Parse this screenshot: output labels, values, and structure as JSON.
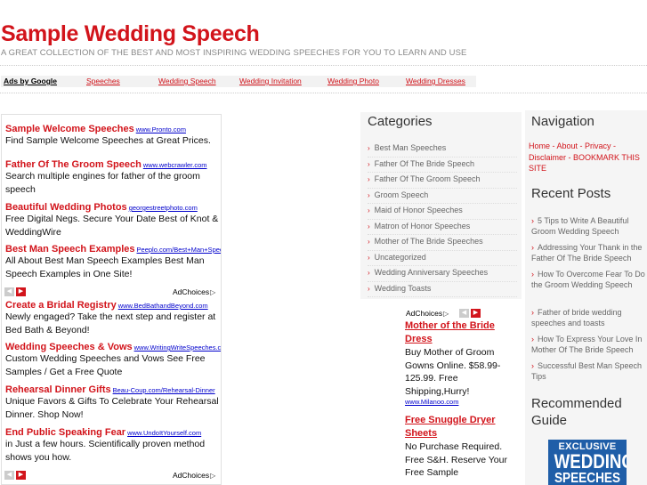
{
  "header": {
    "title": "Sample Wedding Speech",
    "tagline": "A GREAT COLLECTION OF THE BEST AND MOST INSPIRING WEDDING SPEECHES FOR YOU TO LEARN AND USE"
  },
  "adbar": {
    "ads_by": "Ads by Google",
    "links": [
      "Speeches",
      "Wedding Speech",
      "Wedding Invitation",
      "Wedding Photo",
      "Wedding Dresses"
    ]
  },
  "left_ads": [
    {
      "title": "Sample Welcome Speeches",
      "url": "www.Pronto.com",
      "desc": "Find Sample Welcome Speeches at Great Prices."
    },
    {
      "title": "Father Of The Groom Speech",
      "url": "www.webcrawler.com",
      "desc": "Search multiple engines for father of the groom speech"
    },
    {
      "title": "Beautiful Wedding Photos",
      "url": "georgestreetphoto.com",
      "desc": "Free Digital Negs. Secure Your Date Best of Knot & WeddingWire"
    },
    {
      "title": "Best Man Speech Examples",
      "url": "Peeplo.com/Best+Man+Speech",
      "desc": "All About Best Man Speech Examples Best Man Speech Examples in One Site!"
    },
    {
      "title": "Create a Bridal Registry",
      "url": "www.BedBathandBeyond.com",
      "desc": "Newly engaged? Take the next step and register at Bed Bath & Beyond!"
    },
    {
      "title": "Wedding Speeches & Vows",
      "url": "www.WritingWriteSpeeches.com",
      "desc": "Custom Wedding Speeches and Vows See Free Samples / Get a Free Quote"
    },
    {
      "title": "Rehearsal Dinner Gifts",
      "url": "Beau-Coup.com/Rehearsal-Dinner",
      "desc": "Unique Favors & Gifts To Celebrate Your Rehearsal Dinner. Shop Now!"
    },
    {
      "title": "End Public Speaking Fear",
      "url": "www.UndoItYourself.com",
      "desc": "in Just a few hours. Scientifically proven method shows you how."
    }
  ],
  "adchoices": "AdChoices",
  "categories": {
    "title": "Categories",
    "items": [
      "Best Man Speeches",
      "Father Of The Bride Speech",
      "Father Of The Groom Speech",
      "Groom Speech",
      "Maid of Honor Speeches",
      "Matron of Honor Speeches",
      "Mother of The Bride Speeches",
      "Uncategorized",
      "Wedding Anniversary Speeches",
      "Wedding Toasts"
    ]
  },
  "mid_ads": [
    {
      "title": "Mother of the Bride Dress",
      "desc": "Buy Mother of Groom Gowns Online. $58.99-125.99. Free Shipping,Hurry!",
      "url": "www.Milanoo.com"
    },
    {
      "title": "Free Snuggle Dryer Sheets",
      "desc": "No Purchase Required. Free S&H. Reserve Your Free Sample"
    }
  ],
  "navigation": {
    "title": "Navigation",
    "links_text": "Home - About - Privacy - Disclaimer - BOOKMARK THIS SITE"
  },
  "recent_posts": {
    "title": "Recent Posts",
    "items": [
      "5 Tips to Write A Beautiful Groom Wedding Speech",
      "Addressing Your Thank in the Father Of The Bride Speech",
      "How To Overcome Fear To Do the Groom Wedding Speech",
      "Father of bride wedding speeches and toasts",
      "How To Express Your Love In Mother Of The Bride Speech",
      "Successful Best Man Speech Tips"
    ]
  },
  "recommended": {
    "title": "Recommended Guide",
    "badge_line1": "EXCLUSIVE",
    "badge_line2": "WEDDING",
    "badge_line3": "SPEECHES"
  },
  "colors": {
    "accent": "#d2141b",
    "link_blue": "#0000cc",
    "sidebar_bg": "#f5f5f5"
  }
}
